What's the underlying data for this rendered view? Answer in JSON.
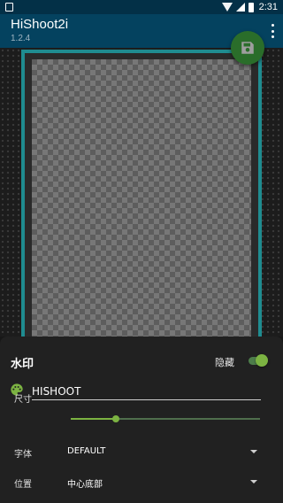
{
  "status_bar": {
    "time": "2:31"
  },
  "app_bar": {
    "title": "HiShoot2i",
    "version": "1.2.4"
  },
  "watermark_panel": {
    "title": "水印",
    "hide_label": "隐藏",
    "hide_enabled": true,
    "text_value": "HISHOOT",
    "size_label": "尺寸",
    "size_fraction": 0.24,
    "font_label": "字体",
    "font_value": "DEFAULT",
    "position_label": "位置",
    "position_value": "中心底部"
  },
  "colors": {
    "accent": "#7cb342",
    "app_bar": "#04425f",
    "frame": "#1f8c90"
  },
  "icons": {
    "notification": "notification-icon",
    "fab": "save-icon",
    "palette": "palette-icon"
  }
}
